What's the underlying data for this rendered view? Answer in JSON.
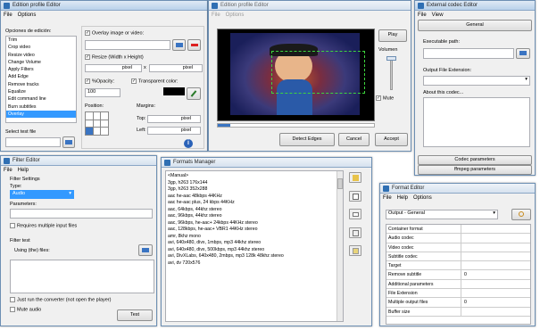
{
  "edition": {
    "title": "Edition profile Editor",
    "menu": [
      "File",
      "Options"
    ],
    "options_label": "Opciones de edición:",
    "items": [
      "Trim",
      "Crop video",
      "Resize video",
      "Change Volume",
      "Apply Filters",
      "Add Edge",
      "Remove tracks",
      "Equalize",
      "Edit command line",
      "Burn subtitles",
      "Overlay"
    ],
    "selected": "Overlay",
    "select_test_file": "Select test file",
    "overlay_label": "Overlay image or video:",
    "resize_label": "Resize (Width x Height)",
    "pixel": "pixel",
    "x": "x",
    "opacity_label": "%Opacity:",
    "opacity_value": "100",
    "transparent_label": "Transparent color:",
    "position_label": "Position:",
    "margins_label": "Margins:",
    "top_label": "Top:",
    "left_label": "Left:"
  },
  "edition2": {
    "title": "Edition profile Editor",
    "menu": [
      "File",
      "Options"
    ],
    "play": "Play",
    "volumen": "Volumen",
    "mute": "Mute",
    "detect_edges": "Detect Edges",
    "cancel": "Cancel",
    "accept": "Accept"
  },
  "codec": {
    "title": "External codec Editor",
    "menu": [
      "File",
      "View"
    ],
    "general": "General",
    "exec_path": "Executable path:",
    "output_ext": "Output File Extension:",
    "about": "About this codec...",
    "codec_params": "Codec parameters",
    "ffmpeg_params": "ffmpeg parameters"
  },
  "filter": {
    "title": "Filter Editor",
    "menu": [
      "File",
      "Help"
    ],
    "settings": "Filter Settings",
    "type_label": "Type:",
    "type_value": "Audio",
    "parameters": "Parameters:",
    "requires": "Requires multiple input files",
    "test": "Filter test",
    "using": "Using (the) files:",
    "just_run": "Just run the converter (not open the player)",
    "mute_audio": "Mute audio",
    "test_btn": "Test"
  },
  "formats_mgr": {
    "title": "Formats Manager",
    "items": [
      "<Manual>",
      "3gp, h263 176x144",
      "3gp, h263 352x288",
      "aac he-aac 48kbps 44KHz",
      "aac he-aac plus, 24 kbps 44KHz",
      "aac, 64kbps, 44khz stereo",
      "aac, 96kbps, 44khz stereo",
      "aac, 96kbps, he-aac+ 24kbps 44KHz stereo",
      "aac, 128kbps, he-aac+ VBR1 44KHz stereo",
      "amr, 8khz mono",
      "avi, 640x480, divx, 1mbps, mp3 44khz stereo",
      "avi, 640x480, divx, 500kbps, mp3 44khz stereo",
      "avi, DivXLabs, 640x480, 2mbps, mp3 128k 48khz stereo",
      "avi, dv 720x576"
    ]
  },
  "format_editor": {
    "title": "Format Editor",
    "menu": [
      "File",
      "Help",
      "Options"
    ],
    "dropdown": "Output - General",
    "rows": [
      {
        "k": "Container format",
        "v": ""
      },
      {
        "k": "Audio codec",
        "v": ""
      },
      {
        "k": "Video codec",
        "v": ""
      },
      {
        "k": "Subtitle codec",
        "v": ""
      },
      {
        "k": "Target",
        "v": ""
      },
      {
        "k": "Remove subtitle",
        "v": "0"
      },
      {
        "k": "Additional parameters",
        "v": ""
      },
      {
        "k": "File Extension",
        "v": ""
      },
      {
        "k": "Multiple output files",
        "v": "0"
      },
      {
        "k": "Buffer size",
        "v": ""
      }
    ]
  }
}
